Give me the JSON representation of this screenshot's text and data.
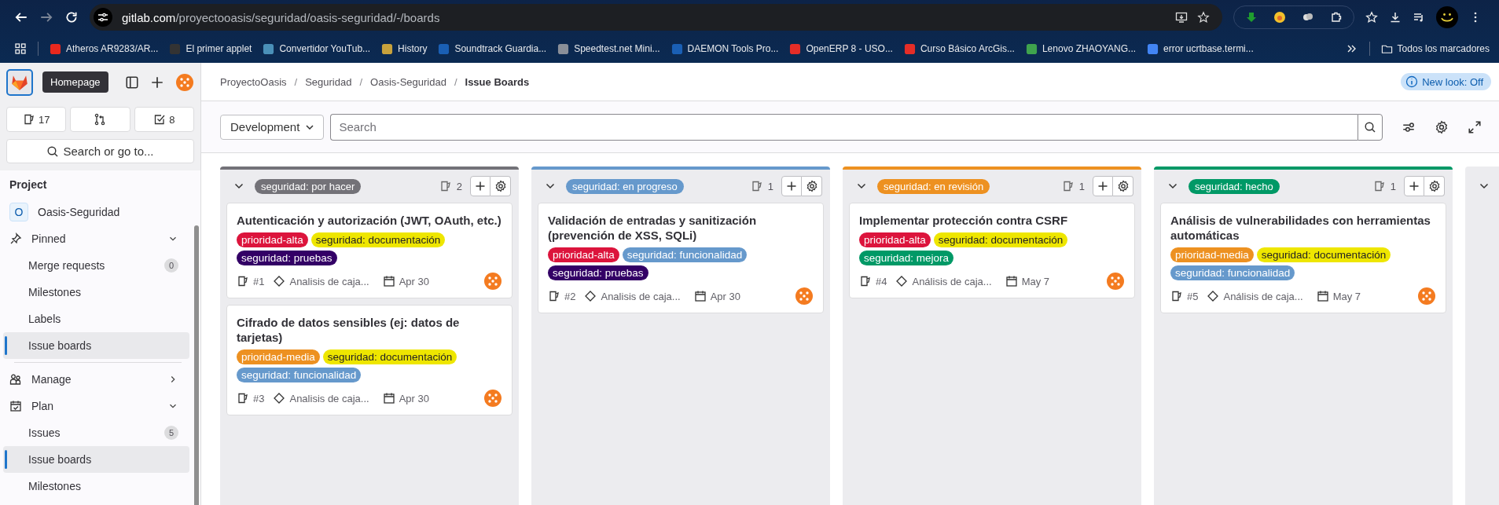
{
  "browser": {
    "url_host": "gitlab.com",
    "url_path": "/proyectooasis/seguridad/oasis-seguridad/-/boards",
    "bookmarks": [
      {
        "text": "Atheros AR9283/AR...",
        "color": "#e8281e"
      },
      {
        "text": "El primer applet",
        "color": "#333333"
      },
      {
        "text": "Convertidor YouTub...",
        "color": "#4a90b8"
      },
      {
        "text": "History",
        "color": "#c8a23c"
      },
      {
        "text": "Soundtrack Guardia...",
        "color": "#1a5fb4"
      },
      {
        "text": "Speedtest.net Mini...",
        "color": "#8a8f98"
      },
      {
        "text": "DAEMON Tools Pro...",
        "color": "#1a5fb4"
      },
      {
        "text": "OpenERP 8 - USO...",
        "color": "#e52d27"
      },
      {
        "text": "Curso Básico ArcGis...",
        "color": "#e52d27"
      },
      {
        "text": "Lenovo ZHAOYANG...",
        "color": "#3fa34d"
      },
      {
        "text": "error ucrtbase.termi...",
        "color": "#4285f4"
      }
    ],
    "bookmarks_folder": "Todos los marcadores"
  },
  "sidebar": {
    "tooltip": "Homepage",
    "issues_count": "17",
    "todos_count": "8",
    "search": "Search or go to...",
    "section_title": "Project",
    "items": [
      {
        "kind": "project",
        "avatar": "O",
        "label": "Oasis-Seguridad"
      },
      {
        "kind": "pinned",
        "label": "Pinned",
        "expanded": true,
        "children": [
          {
            "label": "Merge requests",
            "badge": "0",
            "selected": false
          },
          {
            "label": "Milestones",
            "selected": false
          },
          {
            "label": "Labels",
            "selected": false
          },
          {
            "label": "Issue boards",
            "selected": true
          }
        ]
      },
      {
        "kind": "group",
        "label": "Manage",
        "expanded": false
      },
      {
        "kind": "group",
        "label": "Plan",
        "expanded": true,
        "children": [
          {
            "label": "Issues",
            "badge": "5",
            "selected": false
          },
          {
            "label": "Issue boards",
            "selected": true
          },
          {
            "label": "Milestones",
            "selected": false
          }
        ]
      }
    ]
  },
  "breadcrumbs": [
    "ProyectoOasis",
    "Seguridad",
    "Oasis-Seguridad",
    "Issue Boards"
  ],
  "breadcrumb_separator": "/",
  "new_look": "New look: Off",
  "board_selector": "Development",
  "search": {
    "placeholder": "Search"
  },
  "lists": [
    {
      "label": "seguridad: por hacer",
      "color": "#737278",
      "count": "2",
      "issues": [
        {
          "title": "Autenticación y autorización (JWT, OAuth, etc.)",
          "labels": [
            {
              "text": "prioridad-alta",
              "color": "#dc143c"
            },
            {
              "text": "seguridad: documentación",
              "color": "#eee600"
            },
            {
              "text": "seguridad: pruebas",
              "color": "#330066"
            }
          ],
          "number": "#1",
          "milestone": "Analisis de caja...",
          "due": "Apr 30"
        },
        {
          "title": "Cifrado de datos sensibles (ej: datos de tarjetas)",
          "labels": [
            {
              "text": "prioridad-media",
              "color": "#ed9121"
            },
            {
              "text": "seguridad: documentación",
              "color": "#eee600"
            },
            {
              "text": "seguridad: funcionalidad",
              "color": "#6699cc"
            }
          ],
          "number": "#3",
          "milestone": "Analisis de caja...",
          "due": "Apr 30"
        }
      ]
    },
    {
      "label": "seguridad: en progreso",
      "color": "#6699cc",
      "count": "1",
      "issues": [
        {
          "title": "Validación de entradas y sanitización (prevención de XSS, SQLi)",
          "labels": [
            {
              "text": "prioridad-alta",
              "color": "#dc143c"
            },
            {
              "text": "seguridad: funcionalidad",
              "color": "#6699cc"
            },
            {
              "text": "seguridad: pruebas",
              "color": "#330066"
            }
          ],
          "number": "#2",
          "milestone": "Analisis de caja...",
          "due": "Apr 30"
        }
      ]
    },
    {
      "label": "seguridad: en revisión",
      "color": "#ed9121",
      "count": "1",
      "issues": [
        {
          "title": "Implementar protección contra CSRF",
          "labels": [
            {
              "text": "prioridad-alta",
              "color": "#dc143c"
            },
            {
              "text": "seguridad: documentación",
              "color": "#eee600"
            },
            {
              "text": "seguridad: mejora",
              "color": "#009966"
            }
          ],
          "number": "#4",
          "milestone": "Análisis de caja...",
          "due": "May 7"
        }
      ]
    },
    {
      "label": "seguridad: hecho",
      "color": "#009966",
      "count": "1",
      "issues": [
        {
          "title": "Análisis de vulnerabilidades con herramientas automáticas",
          "labels": [
            {
              "text": "prioridad-media",
              "color": "#ed9121"
            },
            {
              "text": "seguridad: documentación",
              "color": "#eee600"
            },
            {
              "text": "seguridad: funcionalidad",
              "color": "#6699cc"
            }
          ],
          "number": "#5",
          "milestone": "Análisis de caja...",
          "due": "May 7"
        }
      ]
    }
  ]
}
